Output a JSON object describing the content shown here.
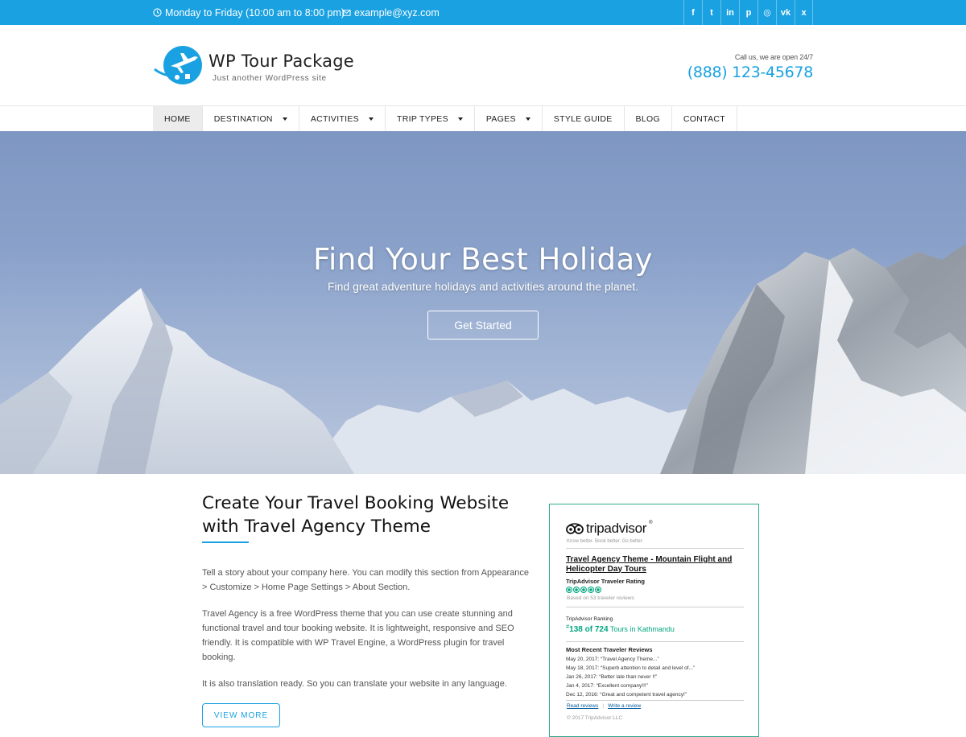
{
  "topbar": {
    "hours": "Monday to Friday (10:00 am to 8:00 pm)",
    "email": "example@xyz.com",
    "social": [
      {
        "icon": "facebook-icon",
        "glyph": "f"
      },
      {
        "icon": "twitter-icon",
        "glyph": "t"
      },
      {
        "icon": "linkedin-icon",
        "glyph": "in"
      },
      {
        "icon": "pinterest-icon",
        "glyph": "p"
      },
      {
        "icon": "instagram-icon",
        "glyph": "◎"
      },
      {
        "icon": "vk-icon",
        "glyph": "vk"
      },
      {
        "icon": "xing-icon",
        "glyph": "x"
      }
    ]
  },
  "header": {
    "title": "WP Tour Package",
    "tagline": "Just another WordPress site",
    "call_label": "Call us, we are open 24/7",
    "phone": "(888) 123-45678"
  },
  "nav": {
    "items": [
      {
        "label": "HOME",
        "active": true,
        "dropdown": false
      },
      {
        "label": "DESTINATION",
        "active": false,
        "dropdown": true
      },
      {
        "label": "ACTIVITIES",
        "active": false,
        "dropdown": true
      },
      {
        "label": "TRIP TYPES",
        "active": false,
        "dropdown": true
      },
      {
        "label": "PAGES",
        "active": false,
        "dropdown": true
      },
      {
        "label": "STYLE GUIDE",
        "active": false,
        "dropdown": false
      },
      {
        "label": "BLOG",
        "active": false,
        "dropdown": false
      },
      {
        "label": "CONTACT",
        "active": false,
        "dropdown": false
      }
    ]
  },
  "hero": {
    "title": "Find Your Best Holiday",
    "subtitle": "Find great adventure holidays and activities around the planet.",
    "button": "Get Started"
  },
  "about": {
    "title": "Create Your Travel Booking Website with Travel Agency Theme",
    "p1": "Tell a story about your company here. You can modify this section from Appearance > Customize > Home Page Settings > About Section.",
    "p2": "Travel Agency is a free WordPress theme that you can use create stunning and functional travel and tour booking website. It is lightweight, responsive and SEO friendly. It is compatible with WP Travel Engine, a WordPress plugin for travel booking.",
    "p3": "It is also translation ready. So you can translate your website in any language.",
    "button": "VIEW MORE"
  },
  "tripadvisor": {
    "logo_text": "tripadvisor",
    "tagline": "Know better. Book better. Go better.",
    "link": "Travel Agency Theme - Mountain Flight and Helicopter Day Tours",
    "rating_label": "TripAdvisor Traveler Rating",
    "rating": 5,
    "based_on": "Based on 53 traveler reviews",
    "rank_label": "TripAdvisor Ranking",
    "rank_hash": "#",
    "rank_value": "138 of 724",
    "rank_suffix": " Tours in Kathmandu",
    "recent_label": "Most Recent Traveler Reviews",
    "reviews": [
      "May 20, 2017: “Travel Agency Theme...”",
      "May 18, 2017: “Superb attention to detail and level of...”",
      "Jan 26, 2017: “Better late than never !!”",
      "Jan 4, 2017: “Excellent company!!!”",
      "Dec 12, 2016: “Great and competent travel agency!”"
    ],
    "read_reviews": "Read reviews",
    "write_review": "Write a review",
    "copyright": "© 2017 TripAdvisor LLC"
  },
  "colors": {
    "accent": "#1aa1e1",
    "tripadvisor_green": "#00a680"
  }
}
